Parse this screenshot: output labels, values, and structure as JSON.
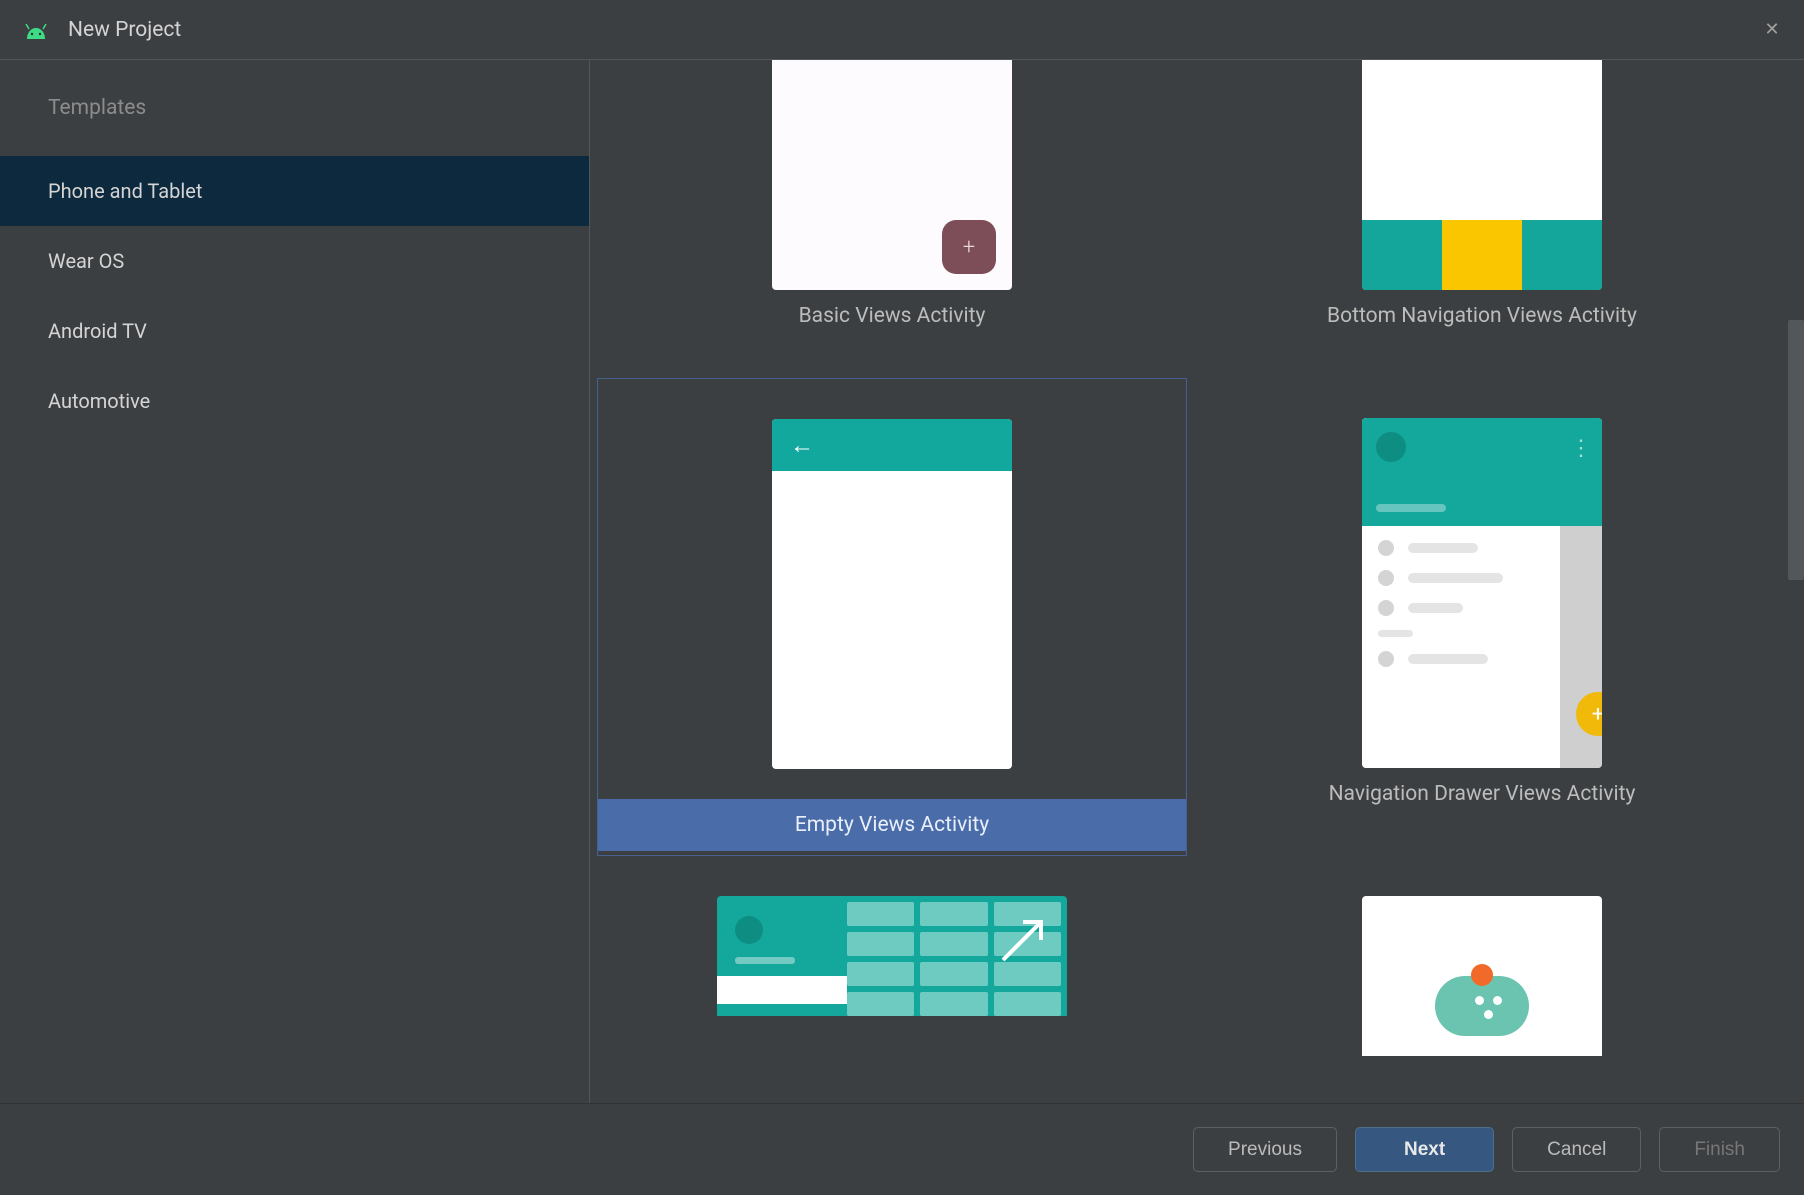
{
  "dialog": {
    "title": "New Project",
    "close_label": "✕"
  },
  "sidebar": {
    "header": "Templates",
    "items": [
      {
        "label": "Phone and Tablet",
        "selected": true
      },
      {
        "label": "Wear OS",
        "selected": false
      },
      {
        "label": "Android TV",
        "selected": false
      },
      {
        "label": "Automotive",
        "selected": false
      }
    ]
  },
  "templates": [
    {
      "label": "Basic Views Activity",
      "selected": false,
      "kind": "basic"
    },
    {
      "label": "Bottom Navigation Views Activity",
      "selected": false,
      "kind": "bottomnav"
    },
    {
      "label": "Empty Views Activity",
      "selected": true,
      "kind": "empty"
    },
    {
      "label": "Navigation Drawer Views Activity",
      "selected": false,
      "kind": "drawer"
    },
    {
      "label": "",
      "selected": false,
      "kind": "fullscreen"
    },
    {
      "label": "",
      "selected": false,
      "kind": "game"
    }
  ],
  "footer": {
    "previous": "Previous",
    "next": "Next",
    "cancel": "Cancel",
    "finish": "Finish"
  },
  "icons": {
    "fab_plus": "+",
    "back_arrow": "←",
    "kebab": "⋮",
    "drawer_fab_plus": "+"
  }
}
